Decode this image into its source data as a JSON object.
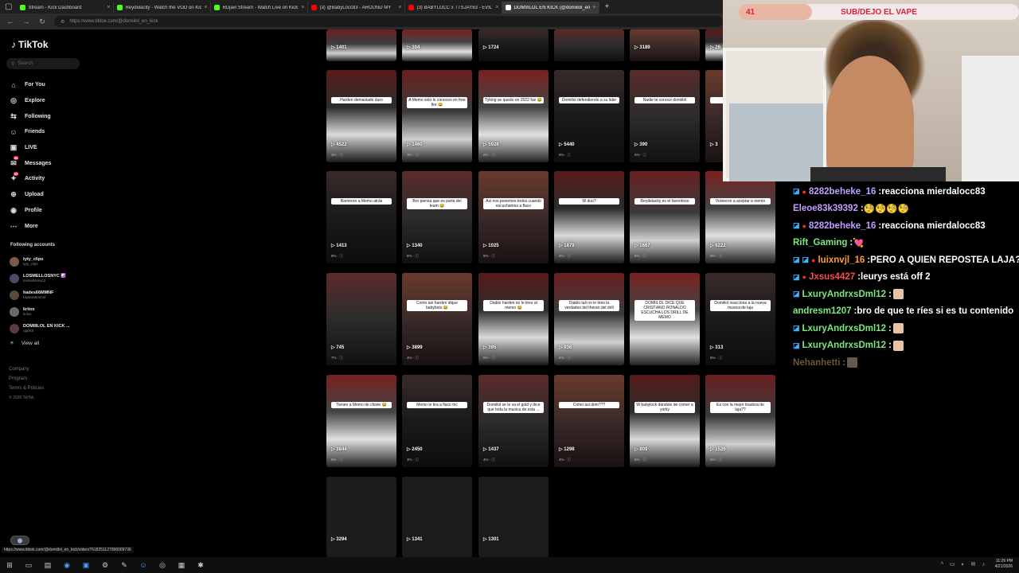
{
  "browser": {
    "tabs": [
      {
        "label": "Stream - Kick Dashboard",
        "color": "#53fc18"
      },
      {
        "label": "Reydelacity - Watch the VOD on Kick",
        "color": "#53fc18"
      },
      {
        "label": "RDjavi Stream - Watch Live on Kick",
        "color": "#53fc18"
      },
      {
        "label": "(3) @BabyLocc83 - AROUND MY",
        "color": "#ff0000"
      },
      {
        "label": "(3) BABYLOCC x TTSJAY83 - EVIL",
        "color": "#ff0000"
      },
      {
        "label": "DOMIIILOL EN KICK (@domiilol_en",
        "color": "#ffffff"
      }
    ],
    "url": "https://www.tiktok.com/@domiilol_en_kick",
    "status_url": "https://www.tiktok.com/@domiilol_en_kick/video/7618251127996009736"
  },
  "tiktok": {
    "logo": "TikTok",
    "search_placeholder": "Search",
    "nav": [
      {
        "label": "For You",
        "icon": "home-icon",
        "glyph": "⌂"
      },
      {
        "label": "Explore",
        "icon": "compass-icon",
        "glyph": "◎"
      },
      {
        "label": "Following",
        "icon": "following-icon",
        "glyph": "⇆"
      },
      {
        "label": "Friends",
        "icon": "friends-icon",
        "glyph": "☺"
      },
      {
        "label": "LIVE",
        "icon": "live-icon",
        "glyph": "▣"
      },
      {
        "label": "Messages",
        "icon": "messages-icon",
        "glyph": "✉",
        "badge": "99"
      },
      {
        "label": "Activity",
        "icon": "activity-icon",
        "glyph": "✦",
        "badge": "99"
      },
      {
        "label": "Upload",
        "icon": "upload-icon",
        "glyph": "⊕"
      },
      {
        "label": "Profile",
        "icon": "profile-icon",
        "glyph": "◉"
      },
      {
        "label": "More",
        "icon": "more-icon",
        "glyph": "⋯"
      }
    ],
    "following_title": "Following accounts",
    "following": [
      {
        "name": "tyty_clips",
        "handle": "tyty_clips"
      },
      {
        "name": "LOSMELLOSNYC ☯️",
        "handle": "losmellosnyc2"
      },
      {
        "name": "hades66MMNF",
        "handle": "hades66mmnf"
      },
      {
        "name": "kriiox",
        "handle": "kriiox"
      },
      {
        "name": "DOMIIILOL EN KICK ...",
        "handle": "ogriilol"
      }
    ],
    "view_all": "View all",
    "footer": [
      "Company",
      "Program",
      "Terms & Policies"
    ],
    "copyright": "© 2026 TikTok",
    "row_top": [
      {
        "views": "1401"
      },
      {
        "views": "304"
      },
      {
        "views": "1724"
      },
      {
        "views": ""
      },
      {
        "views": "3189"
      },
      {
        "views": "28"
      }
    ],
    "row1": [
      {
        "caption": "Harden demasiado duro",
        "views": "4522",
        "meta": "3% · ⓘ"
      },
      {
        "caption": "A Memo solo lo conocen en free fire 😂",
        "views": "1460",
        "meta": "3% · ⓘ"
      },
      {
        "caption": "Tyking se quedo en 2022 fue 😂",
        "views": "5928",
        "meta": "6% · ⓘ"
      },
      {
        "caption": "Domiilol defendiendo a su lider",
        "views": "5440",
        "meta": "8% · ⓘ"
      },
      {
        "caption": "Nadie te conoce domiilol",
        "views": "390",
        "meta": "5% · ⓘ"
      },
      {
        "caption": "Dom",
        "views": "3",
        "meta": ""
      }
    ],
    "row2": [
      {
        "caption": "Barrieron a Memo atrás",
        "views": "1413",
        "meta": "8% · ⓘ"
      },
      {
        "caption": "Bro piensa que es parte del team 😂",
        "views": "1340",
        "meta": "6% · ⓘ"
      },
      {
        "caption": "Asi nos ponemos todos cuando escuchamos a flaco",
        "views": "1025",
        "meta": "9% · ⓘ"
      },
      {
        "caption": "W duo?",
        "views": "1879",
        "meta": "6% · ⓘ"
      },
      {
        "caption": "Reydelacity es el favoritooo",
        "views": "1667",
        "meta": "9% · ⓘ"
      },
      {
        "caption": "Volvieron a aceptar a memo",
        "views": "6222",
        "meta": "5% · ⓘ"
      }
    ],
    "row3": [
      {
        "caption": "",
        "views": "745",
        "meta": "7% · ⓘ"
      },
      {
        "caption": "Como así harden dique babybots 😂",
        "views": "3899",
        "meta": "4% · ⓘ"
      },
      {
        "caption": "Diablo harden no le tires al memo 😂",
        "views": "395",
        "meta": "8% · ⓘ"
      },
      {
        "caption": "Diablo tali no le tires la verdades del theran del drill",
        "views": "936",
        "meta": "4% · ⓘ"
      },
      {
        "caption": "DOMIILOL DICE QUE CRISTIANO RONALDO ESCUCHA LOS DRILL DE MEMO",
        "views": "",
        "meta": ""
      },
      {
        "caption": "Domiilol reacciona a la nueva musica de laja",
        "views": "313",
        "meta": "5% · ⓘ"
      }
    ],
    "row4": [
      {
        "caption": "Tienen a Memo de chiste 😂",
        "views": "3844",
        "meta": "9% · ⓘ"
      },
      {
        "caption": "Memo le tira a flaco mc",
        "views": "2450",
        "meta": "3% · ⓘ"
      },
      {
        "caption": "Domiilol se le va el gold y dice que toda la musica de esta ...",
        "views": "1437",
        "meta": "4% · ⓘ"
      },
      {
        "caption": "Como asi dom???",
        "views": "1298",
        "meta": "4% · ⓘ"
      },
      {
        "caption": "W babylock dándole de comer a yorky",
        "views": "809",
        "meta": "5% · ⓘ"
      },
      {
        "caption": "Es con la mejor tiradora de laja??",
        "views": "1526",
        "meta": "5% · ⓘ"
      }
    ],
    "row5": [
      {
        "views": "3294"
      },
      {
        "views": "1341"
      },
      {
        "views": "1301"
      }
    ]
  },
  "stream": {
    "goal_count": "41",
    "goal_label": "SUB/DEJO EL VAPE",
    "goal_progress": 0.26,
    "chat": [
      {
        "user": "8282beheke_16",
        "user_color": "#c0a0ff",
        "text": "reacciona mierdalocc83",
        "badges": [
          "blue",
          "red"
        ]
      },
      {
        "user": "Eleoe83k39392",
        "user_color": "#c0a0ff",
        "text": "🧐🧐🧐🧐",
        "badges": []
      },
      {
        "user": "8282beheke_16",
        "user_color": "#c0a0ff",
        "text": "reacciona mierdalocc83",
        "badges": [
          "blue",
          "red"
        ]
      },
      {
        "user": "Rift_Gaming",
        "user_color": "#7de87d",
        "text": "💘",
        "badges": []
      },
      {
        "user": "luixnvjl_16",
        "user_color": "#ff9a3c",
        "text": "PERO A QUIEN REPOSTEA LAJA?",
        "badges": [
          "blue",
          "blue",
          "red"
        ]
      },
      {
        "user": "Jxsus4427",
        "user_color": "#ff4b4b",
        "text": "leurys está off 2",
        "badges": [
          "blue",
          "red"
        ]
      },
      {
        "user": "LxuryAndrxsDml12",
        "user_color": "#7de87d",
        "text": "",
        "badges": [
          "blue"
        ],
        "emote": true
      },
      {
        "user": "andresm1207",
        "user_color": "#7de87d",
        "text": "bro de que te ríes si es tu contenido",
        "badges": []
      },
      {
        "user": "LxuryAndrxsDml12",
        "user_color": "#7de87d",
        "text": "",
        "badges": [
          "blue"
        ],
        "emote": true
      },
      {
        "user": "LxuryAndrxsDml12",
        "user_color": "#7de87d",
        "text": "",
        "badges": [
          "blue"
        ],
        "emote": true
      },
      {
        "user": "Nehanhetti",
        "user_color": "#e8c27d",
        "text": "",
        "badges": [],
        "emote": true,
        "faded": true
      }
    ]
  },
  "taskbar": {
    "time": "11:26 PM",
    "date": "4/21/2026"
  }
}
